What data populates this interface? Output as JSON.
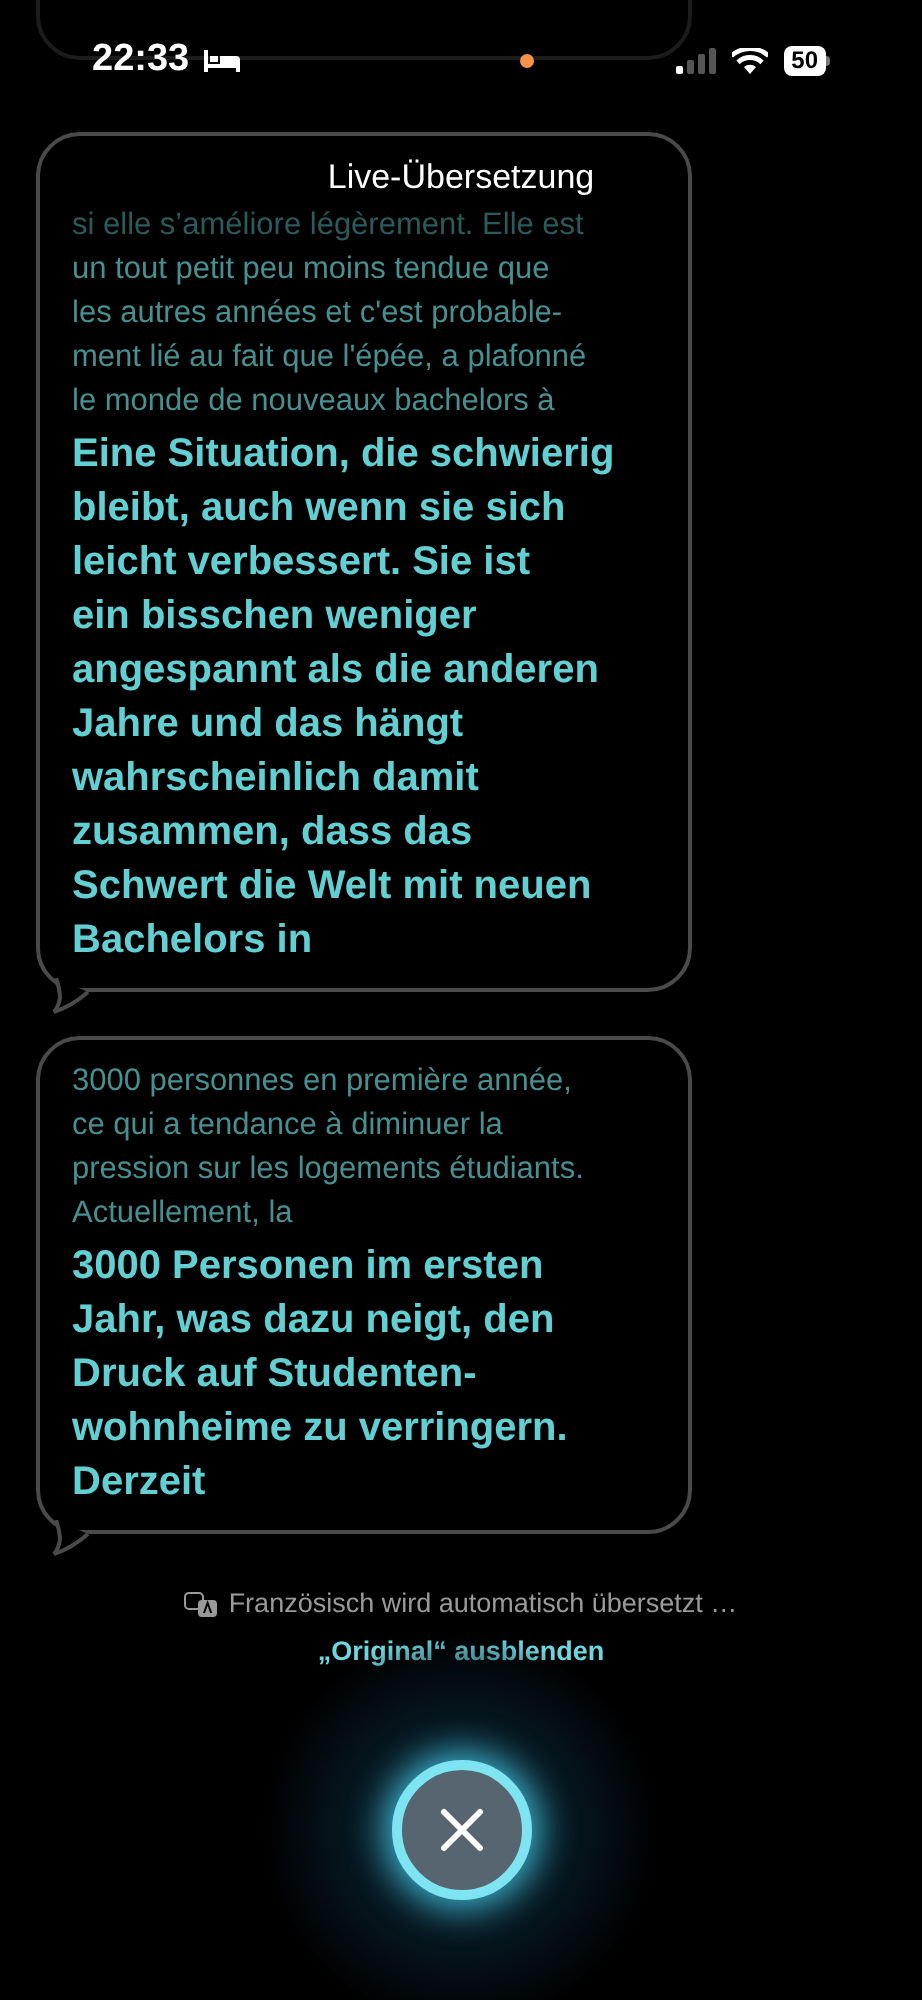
{
  "status_bar": {
    "time": "22:33",
    "battery": "50"
  },
  "title": "Live-Übersetzung",
  "bubbles": [
    {
      "faded": "si elle s’améliore légèrement. Elle est",
      "original": "un tout petit peu moins tendue que\nles autres années et c'est probable-\nment lié au fait que l'épée, a plafonné\nle monde de nouveaux bachelors à",
      "translation": "Eine Situation, die schwierig\nbleibt, auch wenn sie sich\nleicht verbessert. Sie ist\nein bisschen weniger\nangespannt als die anderen\nJahre und das hängt\nwahrscheinlich damit\nzusammen, dass das\nSchwert die Welt mit neuen\nBachelors in"
    },
    {
      "original": "3000 personnes en première année,\nce qui a tendance à diminuer la\npression sur les logements étudiants.\nActuellement, la",
      "translation": "3000 Personen im ersten\nJahr, was dazu neigt, den\nDruck auf Studenten-\nwohnheime zu verringern.\nDerzeit"
    }
  ],
  "footer": {
    "status": "Französisch wird automatisch übersetzt …",
    "toggle": "„Original“ ausblenden"
  }
}
